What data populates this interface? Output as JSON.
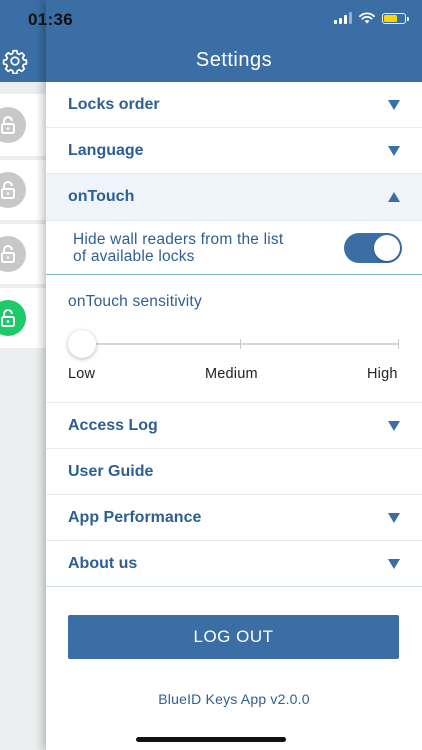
{
  "status_bar": {
    "time": "01:36",
    "battery_color": "#ffd400"
  },
  "header": {
    "title": "Settings",
    "bg_color": "#3a6ea5"
  },
  "side_panel": {
    "settings_icon": "gear-icon",
    "locks": [
      {
        "icon": "lock-icon",
        "state": "inactive",
        "color": "#c8c8c8"
      },
      {
        "icon": "lock-icon",
        "state": "inactive",
        "color": "#c8c8c8"
      },
      {
        "icon": "lock-icon",
        "state": "inactive",
        "color": "#c8c8c8"
      },
      {
        "icon": "lock-icon",
        "state": "active",
        "color": "#1ec96a"
      }
    ]
  },
  "settings": {
    "locks_order": {
      "label": "Locks order",
      "icon": "triangle-down-icon"
    },
    "language": {
      "label": "Language",
      "icon": "triangle-down-icon"
    },
    "ontouch": {
      "label": "onTouch",
      "icon": "triangle-up-icon",
      "hide_wall_readers": {
        "line1": "Hide wall readers from the list",
        "line2": "of available locks",
        "enabled": true
      },
      "sensitivity": {
        "label": "onTouch sensitivity",
        "value": 0,
        "levels": [
          "Low",
          "Medium",
          "High"
        ]
      }
    },
    "access_log": {
      "label": "Access Log",
      "icon": "triangle-down-icon"
    },
    "user_guide": {
      "label": "User Guide"
    },
    "app_performance": {
      "label": "App Performance",
      "icon": "triangle-down-icon"
    },
    "about_us": {
      "label": "About us",
      "icon": "triangle-down-icon"
    }
  },
  "logout": {
    "label": "LOG OUT"
  },
  "footer": {
    "version": "BlueID Keys App v2.0.0"
  },
  "colors": {
    "accent": "#3a6ea5",
    "text": "#2d5f93",
    "active_lock": "#1ec96a"
  }
}
